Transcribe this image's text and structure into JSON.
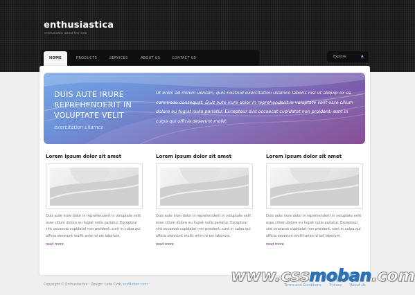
{
  "header": {
    "title": "enthusiastica",
    "tagline": "enthusiastic about the web"
  },
  "nav": {
    "items": [
      "HOME",
      "PRODUCTS",
      "SERVICES",
      "ABOUT US",
      "CONTACT US"
    ],
    "active": "HOME"
  },
  "explore": {
    "label": "Explore",
    "icon": "caret-up-icon"
  },
  "hero": {
    "heading": "DUIS AUTE IRURE REPREHENDERIT IN VOLUPTATE VELIT",
    "subheading": "exercitation ullamco",
    "text": "Ut enim ad minim veniam, quis nostrud exercitation ullamco laboris nisi ut aliquip ex ea commodo consequat. Duis aute irure dolor in reprehenderit in voluptate velit esse cillum dolore eu fugiat nulla pariatur. Excepteur sint occaecat cupidatat non proident, sunt in culpa qui officia deserunt mollit."
  },
  "columns": [
    {
      "title": "Lorem Ipsum dolor sit amet",
      "body": "Duis aute irure dolor in reprehenderit in voluptate velit esse cillum dolore eu fugiat nulla pariatur. Excepteur sint occaecat cupidatat non proident, sunt in culpa qui officia deserunt mollit anim id est laborum.",
      "more": "read more"
    },
    {
      "title": "Lorem Ipsum dolor sit amet",
      "body": "Duis aute irure dolor in reprehenderit in voluptate velit esse cillum dolore eu fugiat nulla pariatur. Excepteur sint occaecat cupidatat non proident, sunt in culpa qui officia deserunt mollit anim id est laborum.",
      "more": "read more"
    },
    {
      "title": "Lorem Ipsum dolor sit amet",
      "body": "Duis aute irure dolor in reprehenderit in voluptate velit esse cillum dolore eu fugiat nulla pariatur. Excepteur sint occaecat cupidatat non proident, sunt in culpa qui officia deserunt mollit anim id est laborum.",
      "more": "read more"
    }
  ],
  "footer": {
    "copyright": "Copyright © Enthusiastica - Design: Luka Cvrk,",
    "credit_link": "cssMoban.com",
    "links": [
      "Terms and Conditions",
      "Privacy",
      "About Us"
    ]
  },
  "watermark": {
    "left": "www.css",
    "mid": "moban",
    "right": ".com"
  },
  "colors": {
    "header_bg": "#1a1a1a",
    "hero_start": "#73a7e6",
    "hero_end": "#7e3f8d",
    "link": "#6aa5d8",
    "read_more": "#6f2a7c"
  }
}
